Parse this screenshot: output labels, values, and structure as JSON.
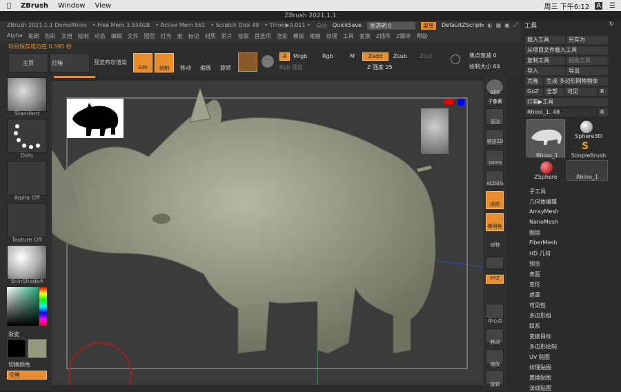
{
  "mac_menu": {
    "apple_icon": "apple-icon",
    "app": "ZBrush",
    "window": "Window",
    "view": "View",
    "clock": "周三 下午6:12",
    "a_icon": "A"
  },
  "window_title": "ZBrush 2021.1.1",
  "menu1": {
    "status": "ZBrush 2021.1.1 DemoRhino",
    "free_mem": "• Free Mem 3.534GB",
    "active_mem": "• Active Mem 561",
    "scratch": "• Scratch Disk 49",
    "timer": "• Timer▶0.011 •",
    "autosave": "自动",
    "quicksave": "QuickSave",
    "transparency": "图透明 0",
    "menus": "菜单",
    "script": "DefaultZScript"
  },
  "menu2": [
    "Alpha",
    "笔刷",
    "色彩",
    "文档",
    "绘制",
    "动态",
    "编辑",
    "文件",
    "图层",
    "灯光",
    "宏",
    "标记",
    "材质",
    "影片",
    "拾取",
    "首选项",
    "渲染",
    "模板",
    "笔触",
    "纹理",
    "工具",
    "变换",
    "Z插件",
    "Z脚本",
    "帮助"
  ],
  "notification": "项目保存成功在 0.595 秒",
  "shelf": {
    "home": "主页",
    "light": "灯箱",
    "preview": "预览布尔渲染",
    "edit": "Edit",
    "draw": "绘制",
    "move": "移动",
    "scale": "缩放",
    "rotate": "旋转",
    "a": "A",
    "mrgb": "Mrgb",
    "rgb": "Rgb",
    "m": "M",
    "zadd": "Zadd",
    "zsub": "Zsub",
    "zcut": "Zcut",
    "rgb_intensity": "Rgb 强度",
    "z_intensity": "Z 强度 25",
    "focal": "焦点衰减 0",
    "draw_size": "绘制大小 64"
  },
  "left": {
    "brush": "Standard",
    "stroke": "Dots",
    "alpha": "Alpha Off",
    "texture": "Texture Off",
    "material": "SkinShade4",
    "gradient": "渐变",
    "switch_color": "切换颜色",
    "alternate": "交替"
  },
  "right_strip": [
    "BPR",
    "子像素",
    "滚动",
    "缩放2D",
    "100%",
    "AC50%",
    "透视",
    "楼网格",
    "对称",
    "",
    "XYZ",
    "",
    "中心点",
    "移动",
    "缩放",
    "旋转"
  ],
  "tool_panel": {
    "title": "工具",
    "load": "载入工具",
    "save_as": "另存为",
    "load_project": "从项目文件载入工具",
    "copy": "复制工具",
    "paste": "粘贴工具",
    "import": "导入",
    "export": "导出",
    "clone": "克隆",
    "make_polymesh": "生成 多边形网格物体",
    "goz": "GoZ",
    "all": "全部",
    "visible": "可见",
    "r": "R",
    "lightbox_tools": "灯箱▶工具",
    "current": "Rhino_1. 48",
    "thumbs": [
      "Rhino_1",
      "Sphere3D",
      "SimpleBrush",
      "ZSphere",
      "Rhino_1"
    ],
    "list": [
      "子工具",
      "几何体编辑",
      "ArrayMesh",
      "NanoMesh",
      "图层",
      "FiberMesh",
      "HD 几何",
      "预览",
      "表面",
      "变形",
      "遮罩",
      "可见性",
      "多边形组",
      "联系",
      "变换目标",
      "多边形绘制",
      "UV 贴图",
      "纹理贴图",
      "置换贴图",
      "法线贴图"
    ]
  },
  "colors": {
    "accent": "#e88c2c",
    "mesh": "#8f9480",
    "bg": "#3b3b3b"
  }
}
